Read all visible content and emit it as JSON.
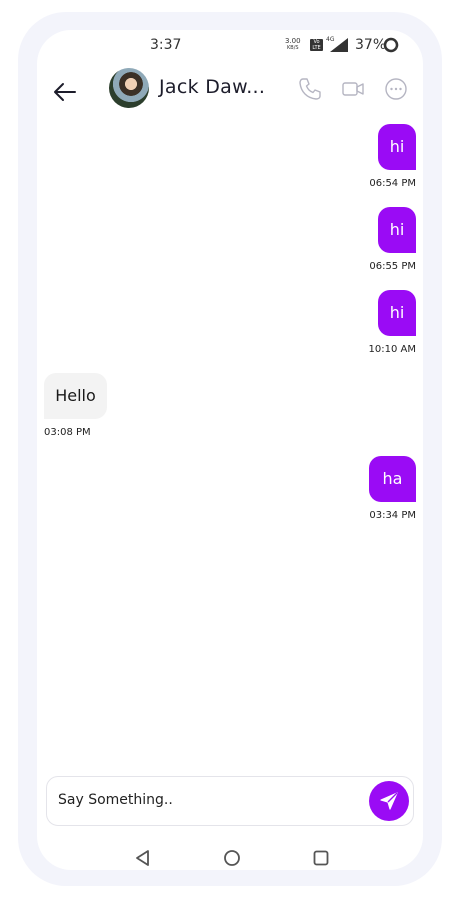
{
  "status_bar": {
    "time": "3:37",
    "net_speed_value": "3.00",
    "net_speed_unit": "KB/S",
    "volte": "Vo LTE",
    "network": "4G",
    "battery": "37%"
  },
  "header": {
    "contact_name": "Jack Daw...",
    "back_icon": "arrow-left-icon",
    "call_icon": "phone-icon",
    "video_icon": "video-icon",
    "more_icon": "more-dots-icon"
  },
  "messages": [
    {
      "direction": "out",
      "text": "hi",
      "time": "06:54 PM"
    },
    {
      "direction": "out",
      "text": "hi",
      "time": "06:55 PM"
    },
    {
      "direction": "out",
      "text": "hi",
      "time": "10:10 AM"
    },
    {
      "direction": "in",
      "text": "Hello",
      "time": "03:08 PM"
    },
    {
      "direction": "out",
      "text": "ha",
      "time": "03:34 PM"
    }
  ],
  "composer": {
    "placeholder": "Say Something..",
    "send_icon": "send-icon"
  },
  "nav_bar": {
    "back_icon": "triangle-back-icon",
    "home_icon": "circle-home-icon",
    "recents_icon": "square-recents-icon"
  },
  "colors": {
    "accent": "#9a0bf5",
    "incoming_bubble": "#f3f3f3",
    "frame": "#f3f4fb"
  }
}
